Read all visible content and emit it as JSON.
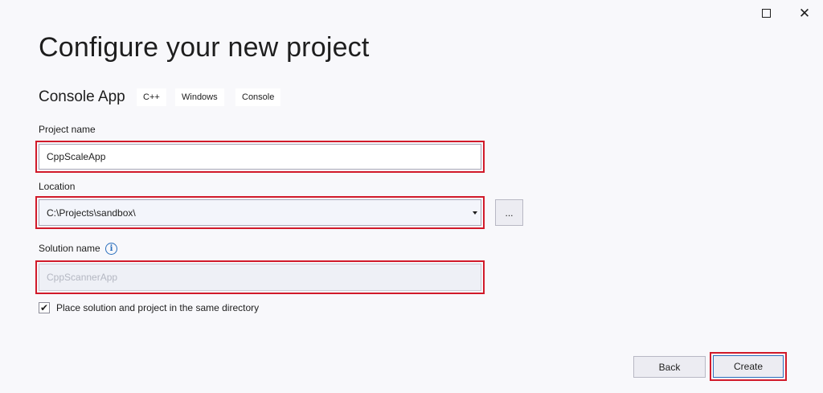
{
  "window": {
    "maximize_icon": "maximize-icon",
    "close_icon": "close-icon",
    "close_glyph": "✕"
  },
  "header": {
    "title": "Configure your new project"
  },
  "template": {
    "name": "Console App",
    "tags": [
      "C++",
      "Windows",
      "Console"
    ]
  },
  "form": {
    "project_name": {
      "label": "Project name",
      "value": "CppScaleApp"
    },
    "location": {
      "label": "Location",
      "value": "C:\\Projects\\sandbox\\",
      "browse_label": "..."
    },
    "solution_name": {
      "label": "Solution name",
      "value": "CppScannerApp",
      "info_glyph": "i",
      "disabled": true
    },
    "same_directory": {
      "label": "Place solution and project in the same directory",
      "checked": true,
      "check_glyph": "✔"
    }
  },
  "footer": {
    "back_label": "Back",
    "create_label": "Create"
  },
  "colors": {
    "highlight": "#d11a2a",
    "accent": "#2a6fbd",
    "background": "#f8f8fb"
  }
}
